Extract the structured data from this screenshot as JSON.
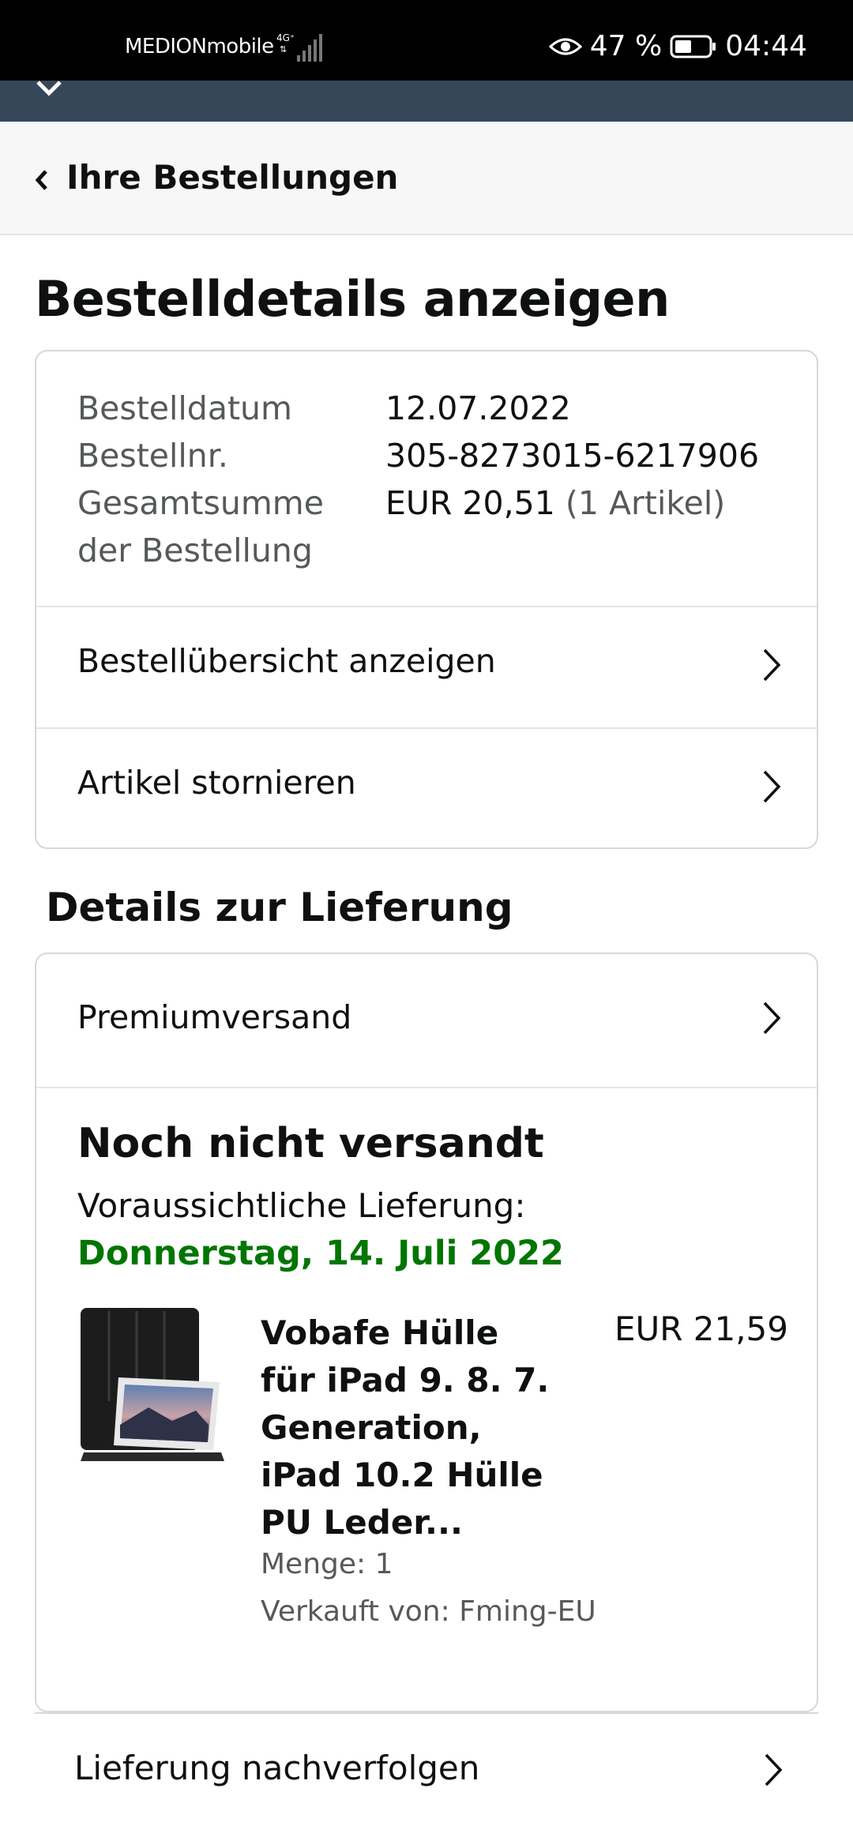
{
  "status_bar": {
    "carrier": "MEDIONmobile",
    "battery_percent": "47 %",
    "time": "04:44",
    "icons": [
      "eye-icon",
      "battery-icon",
      "signal-icon"
    ]
  },
  "nav": {
    "back_label": "Ihre Bestellungen"
  },
  "page_title": "Bestelldetails anzeigen",
  "order": {
    "date_label": "Bestelldatum",
    "date_value": "12.07.2022",
    "number_label": "Bestellnr.",
    "number_value": "305-8273015-6217906",
    "total_label_line1": "Gesamtsumme",
    "total_label_line2": "der Bestellung",
    "total_value": "EUR 20,51",
    "total_items": "(1 Artikel)",
    "summary_link": "Bestellübersicht anzeigen",
    "cancel_link": "Artikel stornieren"
  },
  "delivery": {
    "section_title": "Details zur Lieferung",
    "shipping_method": "Premiumversand",
    "status": "Noch nicht versandt",
    "eta_label": "Voraussichtliche Lieferung:",
    "eta_date": "Donnerstag, 14. Juli 2022",
    "product": {
      "title": "Vobafe Hülle für iPad 9. 8. 7. Generation, iPad 10.2 Hülle PU Leder...",
      "price": "EUR 21,59",
      "quantity": "Menge: 1",
      "seller": "Verkauft von: Fming-EU"
    },
    "track_link": "Lieferung nachverfolgen"
  },
  "colors": {
    "status_bar_bg": "#000000",
    "header_strip": "#37475a",
    "eta_green": "#007600",
    "muted_text": "#565959"
  }
}
